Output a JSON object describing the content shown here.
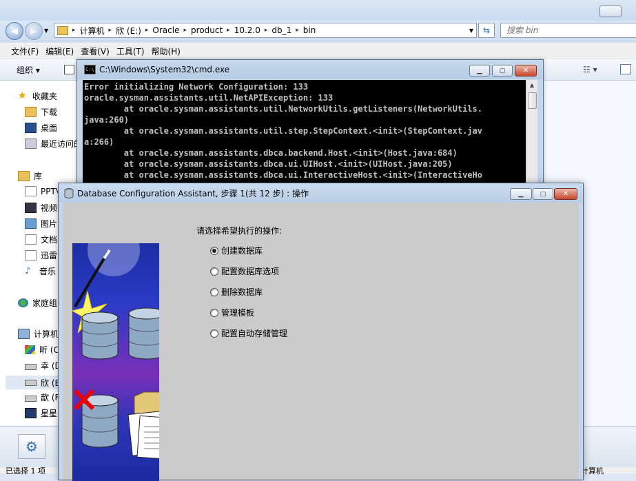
{
  "explorer": {
    "address": {
      "segments": [
        "计算机",
        "欣 (E:)",
        "Oracle",
        "product",
        "10.2.0",
        "db_1",
        "bin"
      ]
    },
    "search_placeholder": "搜索 bin",
    "menu": [
      "文件(F)",
      "编辑(E)",
      "查看(V)",
      "工具(T)",
      "帮助(H)"
    ],
    "toolbar": {
      "organize": "组织 ▾"
    },
    "sidebar": {
      "favorites": "收藏夹",
      "downloads": "下载",
      "desktop": "桌面",
      "recent": "最近访问的",
      "library": "库",
      "pptv": "PPTV",
      "video": "视频",
      "pictures": "图片",
      "documents": "文档",
      "xunlei": "迅雷",
      "music": "音乐",
      "homegroup": "家庭组",
      "computer": "计算机",
      "drive_c": "昕 (C",
      "drive_d": "幸 (D",
      "drive_e": "欣 (E",
      "drive_f": "歆 (F",
      "drive_x": "星星"
    },
    "status": {
      "left": "已选择 1 项",
      "right": "计算机"
    }
  },
  "cmd": {
    "title": "C:\\Windows\\System32\\cmd.exe",
    "lines": [
      "Error initializing Network Configuration: 133",
      "oracle.sysman.assistants.util.NetAPIException: 133",
      "        at oracle.sysman.assistants.util.NetworkUtils.getListeners(NetworkUtils.",
      "java:260)",
      "        at oracle.sysman.assistants.util.step.StepContext.<init>(StepContext.jav",
      "a:266)",
      "        at oracle.sysman.assistants.dbca.backend.Host.<init>(Host.java:684)",
      "        at oracle.sysman.assistants.dbca.ui.UIHost.<init>(UIHost.java:205)",
      "        at oracle.sysman.assistants.dbca.ui.InteractiveHost.<init>(InteractiveHo"
    ]
  },
  "dbca": {
    "title": "Database Configuration Assistant, 步骤 1(共 12 步) : 操作",
    "prompt": "请选择希望执行的操作:",
    "options": [
      {
        "label": "创建数据库",
        "selected": true
      },
      {
        "label": "配置数据库选项",
        "selected": false
      },
      {
        "label": "删除数据库",
        "selected": false
      },
      {
        "label": "管理模板",
        "selected": false
      },
      {
        "label": "配置自动存储管理",
        "selected": false
      }
    ]
  },
  "colors": {
    "console_bg": "#000000",
    "console_fg": "#c0c0c0",
    "titlebar": "#c5d6ea",
    "dialog_body": "#cbcbcb"
  }
}
